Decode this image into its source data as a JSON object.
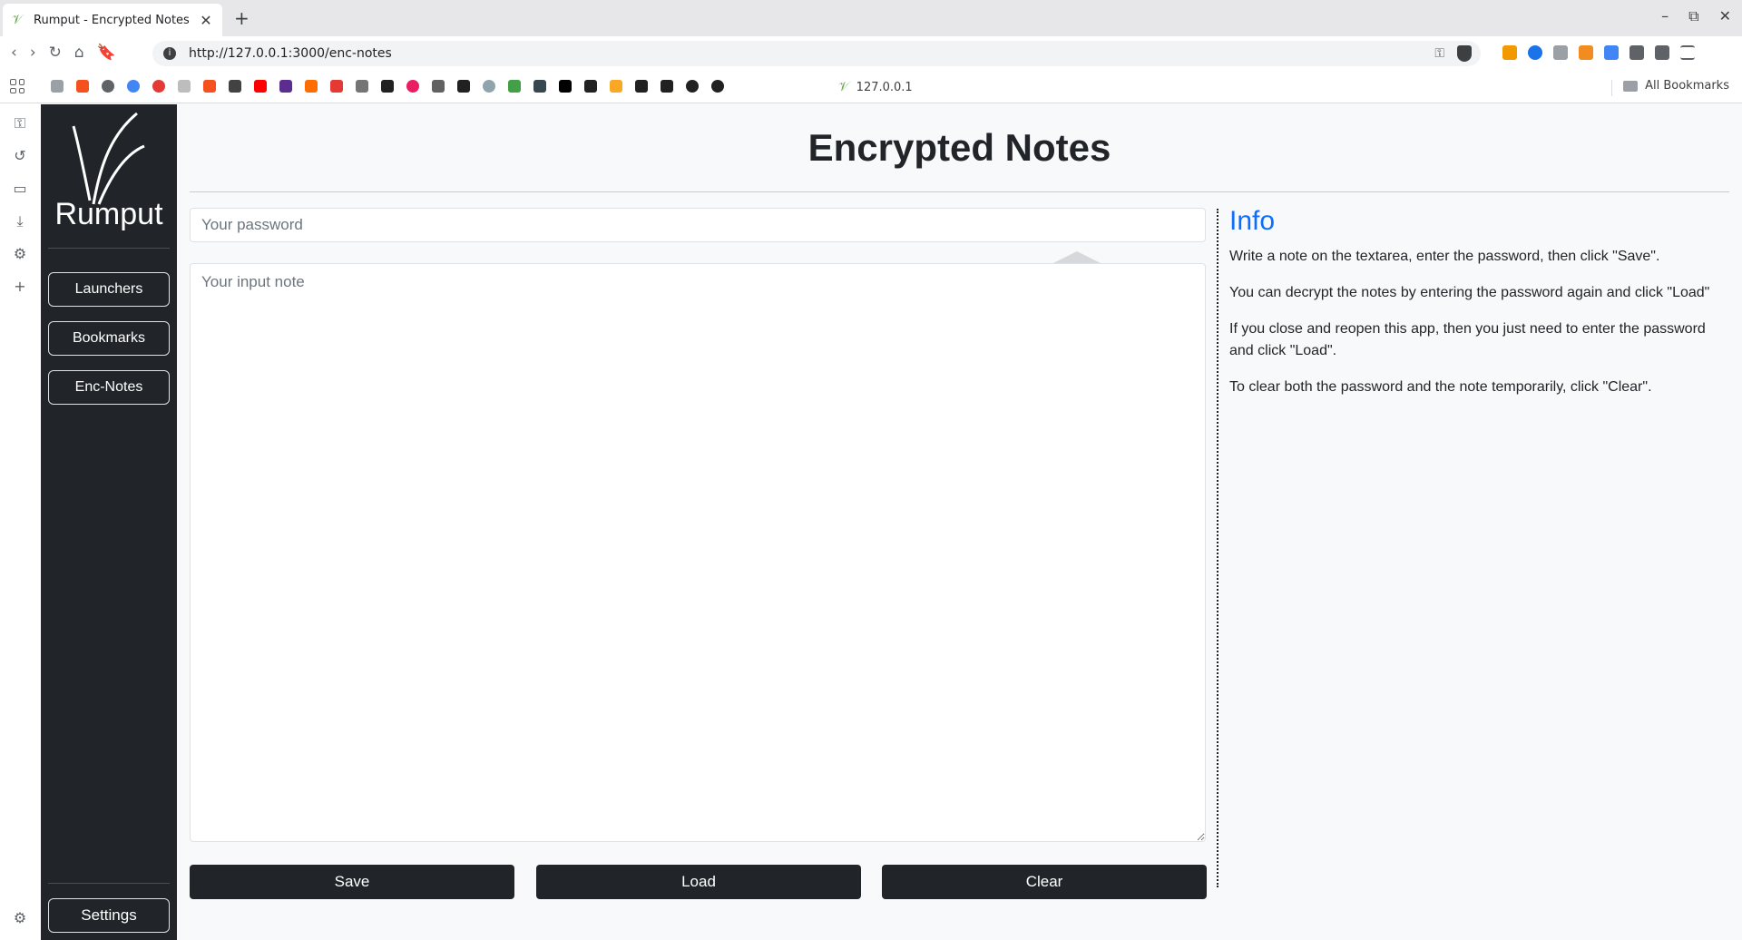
{
  "browser": {
    "tab_title": "Rumput - Encrypted Notes",
    "tab_close": "✕",
    "new_tab": "+",
    "url": "http://127.0.0.1:3000/enc-notes",
    "bookmark_local": "127.0.0.1",
    "all_bookmarks": "All Bookmarks",
    "window_controls": [
      "–",
      "⧉",
      "✕"
    ],
    "nav_icons": [
      "‹",
      "›",
      "↻",
      "⌂",
      "🔖"
    ]
  },
  "sidebar": {
    "brand": "Rumput",
    "nav": [
      {
        "label": "Launchers"
      },
      {
        "label": "Bookmarks"
      },
      {
        "label": "Enc-Notes"
      }
    ],
    "settings_label": "Settings"
  },
  "main": {
    "title": "Encrypted Notes",
    "password_placeholder": "Your password",
    "note_placeholder": "Your input note",
    "buttons": {
      "save": "Save",
      "load": "Load",
      "clear": "Clear"
    }
  },
  "info": {
    "title": "Info",
    "paragraphs": [
      "Write a note on the textarea, enter the password, then click \"Save\".",
      "You can decrypt the notes by entering the password again and click \"Load\"",
      "If you close and reopen this app, then you just need to enter the password and click \"Load\".",
      "To clear both the password and the note temporarily, click \"Clear\"."
    ]
  },
  "colors": {
    "sidebar_bg": "#212529",
    "accent": "#0d6efd",
    "button_bg": "#212529"
  }
}
